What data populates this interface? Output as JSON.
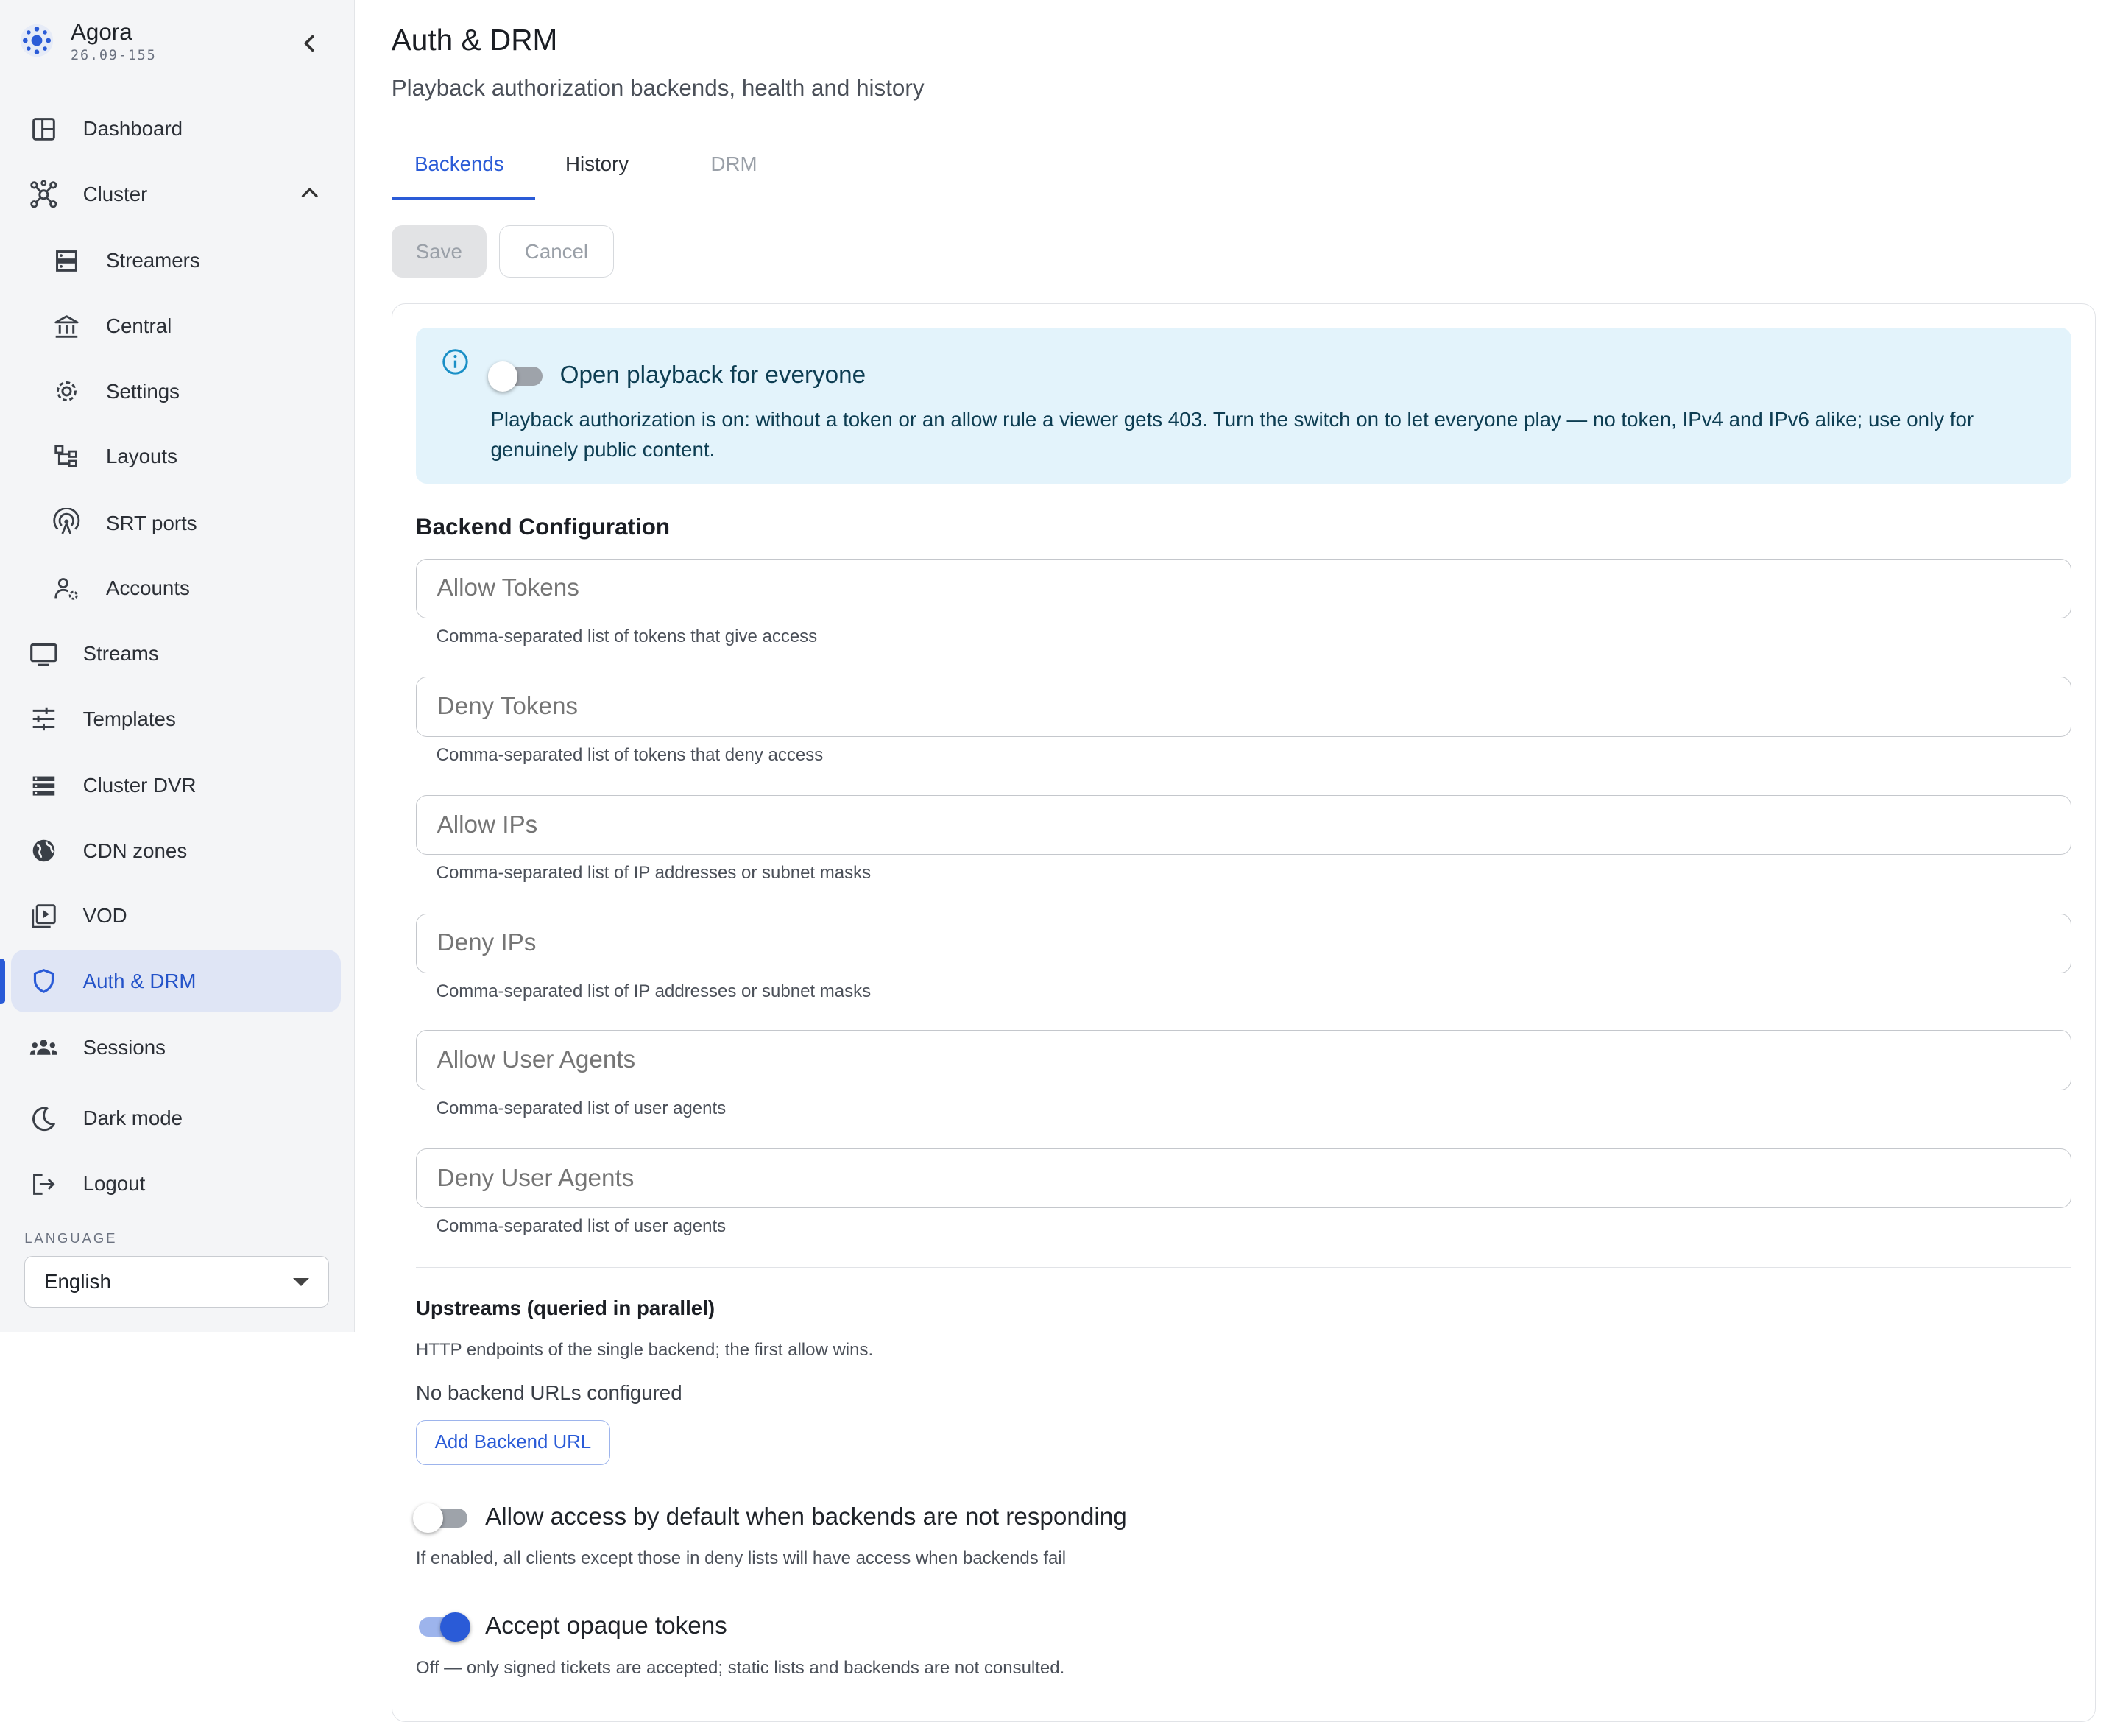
{
  "app": {
    "name": "Agora",
    "version": "26.09-155"
  },
  "sidebar": {
    "items": [
      {
        "label": "Dashboard",
        "icon": "dashboard-icon"
      },
      {
        "label": "Cluster",
        "icon": "cluster-icon",
        "expanded": true
      },
      {
        "label": "Streamers",
        "icon": "server-icon",
        "sub": true
      },
      {
        "label": "Central",
        "icon": "bank-icon",
        "sub": true
      },
      {
        "label": "Settings",
        "icon": "gear-icon",
        "sub": true
      },
      {
        "label": "Layouts",
        "icon": "layout-icon",
        "sub": true
      },
      {
        "label": "SRT ports",
        "icon": "antenna-icon",
        "sub": true
      },
      {
        "label": "Accounts",
        "icon": "user-gear-icon",
        "sub": true
      },
      {
        "label": "Streams",
        "icon": "monitor-icon"
      },
      {
        "label": "Templates",
        "icon": "sliders-icon"
      },
      {
        "label": "Cluster DVR",
        "icon": "storage-icon"
      },
      {
        "label": "CDN zones",
        "icon": "globe-icon"
      },
      {
        "label": "VOD",
        "icon": "video-library-icon"
      },
      {
        "label": "Auth & DRM",
        "icon": "shield-icon",
        "active": true
      },
      {
        "label": "Sessions",
        "icon": "group-icon"
      },
      {
        "label": "Dark mode",
        "icon": "moon-icon"
      },
      {
        "label": "Logout",
        "icon": "logout-icon"
      }
    ],
    "language_label": "LANGUAGE",
    "language_value": "English"
  },
  "page": {
    "title": "Auth & DRM",
    "subtitle": "Playback authorization backends, health and history",
    "tabs": [
      "Backends",
      "History",
      "DRM"
    ],
    "active_tab": "Backends"
  },
  "toolbar": {
    "save_label": "Save",
    "cancel_label": "Cancel"
  },
  "info": {
    "toggle_on": false,
    "title": "Open playback for everyone",
    "text": "Playback authorization is on: without a token or an allow rule a viewer gets 403. Turn the switch on to let everyone play — no token, IPv4 and IPv6 alike; use only for genuinely public content."
  },
  "backend_config": {
    "heading": "Backend Configuration",
    "fields": [
      {
        "placeholder": "Allow Tokens",
        "helper": "Comma-separated list of tokens that give access"
      },
      {
        "placeholder": "Deny Tokens",
        "helper": "Comma-separated list of tokens that deny access"
      },
      {
        "placeholder": "Allow IPs",
        "helper": "Comma-separated list of IP addresses or subnet masks"
      },
      {
        "placeholder": "Deny IPs",
        "helper": "Comma-separated list of IP addresses or subnet masks"
      },
      {
        "placeholder": "Allow User Agents",
        "helper": "Comma-separated list of user agents"
      },
      {
        "placeholder": "Deny User Agents",
        "helper": "Comma-separated list of user agents"
      }
    ]
  },
  "upstreams": {
    "title": "Upstreams (queried in parallel)",
    "description": "HTTP endpoints of the single backend; the first allow wins.",
    "empty_text": "No backend URLs configured",
    "add_label": "Add Backend URL"
  },
  "options": [
    {
      "label": "Allow access by default when backends are not responding",
      "help": "If enabled, all clients except those in deny lists will have access when backends fail",
      "on": false
    },
    {
      "label": "Accept opaque tokens",
      "help": "Off — only signed tickets are accepted; static lists and backends are not consulted.",
      "on": true
    }
  ],
  "colors": {
    "accent": "#2a5bd7",
    "info_bg": "#e3f3fb",
    "sidebar_bg": "#f4f5f7",
    "active_item_bg": "#dfe5f5"
  }
}
